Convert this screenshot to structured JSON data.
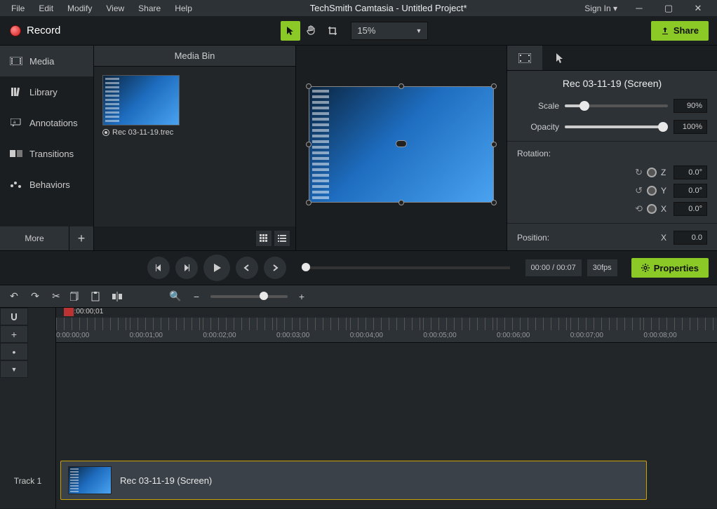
{
  "menu": {
    "items": [
      "File",
      "Edit",
      "Modify",
      "View",
      "Share",
      "Help"
    ],
    "title": "TechSmith Camtasia - Untitled Project*"
  },
  "signin": "Sign In ▾",
  "record": "Record",
  "zoom": "15%",
  "share": "Share",
  "sidebar": {
    "items": [
      {
        "label": "Media"
      },
      {
        "label": "Library"
      },
      {
        "label": "Annotations"
      },
      {
        "label": "Transitions"
      },
      {
        "label": "Behaviors"
      }
    ],
    "more": "More"
  },
  "bin": {
    "header": "Media Bin",
    "clip_name": "Rec 03-11-19.trec"
  },
  "props": {
    "title": "Rec 03-11-19 (Screen)",
    "scale_label": "Scale",
    "scale_value": "90%",
    "opacity_label": "Opacity",
    "opacity_value": "100%",
    "rotation_label": "Rotation:",
    "z_label": "Z",
    "z_value": "0.0°",
    "y_label": "Y",
    "y_value": "0.0°",
    "x_label": "X",
    "x_value": "0.0°",
    "position_label": "Position:",
    "pos_x_label": "X",
    "pos_x_value": "0.0"
  },
  "playback": {
    "time": "00:00 / 00:07",
    "fps": "30fps",
    "properties": "Properties"
  },
  "timeline": {
    "playhead_time": "0:00:00;01",
    "ticks": [
      "0:00:00;00",
      "0:00:01;00",
      "0:00:02;00",
      "0:00:03;00",
      "0:00:04;00",
      "0:00:05;00",
      "0:00:06;00",
      "0:00:07;00",
      "0:00:08;00"
    ],
    "track_label": "Track 1",
    "clip_label": "Rec 03-11-19 (Screen)"
  }
}
